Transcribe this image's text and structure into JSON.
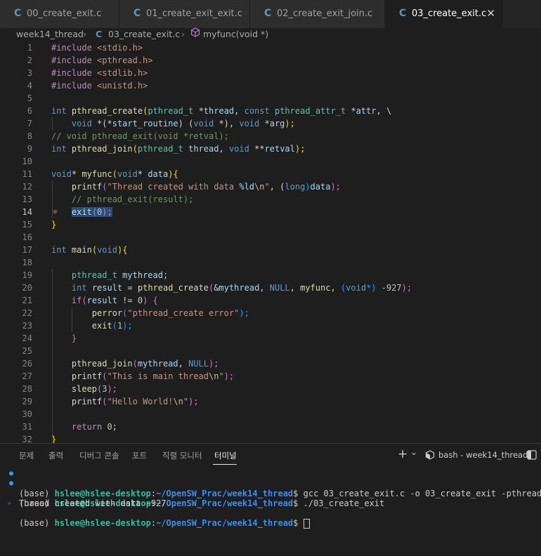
{
  "tabs": [
    {
      "label": "00_create_exit.c",
      "active": false
    },
    {
      "label": "01_create_exit_exit.c",
      "active": false
    },
    {
      "label": "02_create_exit_join.c",
      "active": false
    },
    {
      "label": "03_create_exit.c",
      "active": true
    }
  ],
  "tab_icon": "C",
  "close_glyph": "✕",
  "breadcrumb": {
    "folder": "week14_thread",
    "file": "03_create_exit.c",
    "symbol": "myfunc(void *)",
    "separator": "›"
  },
  "line_numbers": [
    "1",
    "2",
    "3",
    "4",
    "5",
    "6",
    "7",
    "8",
    "9",
    "10",
    "11",
    "12",
    "13",
    "14",
    "15",
    "16",
    "17",
    "18",
    "19",
    "20",
    "21",
    "22",
    "23",
    "24",
    "25",
    "26",
    "27",
    "28",
    "29",
    "30",
    "31",
    "32"
  ],
  "current_line": 14,
  "code": {
    "l1": [
      "#include ",
      "<stdio.h>"
    ],
    "l2": [
      "#include ",
      "<pthread.h>"
    ],
    "l3": [
      "#include ",
      "<stdlib.h>"
    ],
    "l4": [
      "#include ",
      "<unistd.h>"
    ],
    "l6": [
      "int",
      " ",
      "pthread_create",
      "(",
      "pthread_t",
      " *",
      "thread",
      ", ",
      "const",
      " ",
      "pthread_attr_t",
      " *",
      "attr",
      ", \\"
    ],
    "l7": [
      "void",
      " *(*",
      "start_routine",
      ") (",
      "void",
      " *), ",
      "void",
      " *",
      "arg",
      ");"
    ],
    "l8": "// void pthread_exit(void *retval);",
    "l9": [
      "int",
      " ",
      "pthread_join",
      "(",
      "pthread_t",
      " ",
      "thread",
      ", ",
      "void",
      " **",
      "retval",
      ");"
    ],
    "l11": [
      "void",
      "* ",
      "myfunc",
      "(",
      "void",
      "* ",
      "data",
      ")",
      "{"
    ],
    "l12": [
      "printf",
      "(",
      "\"Thread created with data ",
      "%ld",
      "\\n",
      "\"",
      ", (",
      "long",
      ")",
      "data",
      ");"
    ],
    "l13": "// pthread_exit(result);",
    "l14": [
      "exit",
      "(",
      "0",
      ");"
    ],
    "l15": "}",
    "l17": [
      "int",
      " ",
      "main",
      "(",
      "void",
      ")",
      "{"
    ],
    "l19": [
      "pthread_t",
      " ",
      "mythread",
      ";"
    ],
    "l20": [
      "int",
      " ",
      "result",
      " = ",
      "pthread_create",
      "(",
      "&",
      "mythread",
      ", ",
      "NULL",
      ", ",
      "myfunc",
      ", ",
      "(",
      "void",
      "*) ",
      "-927",
      ");"
    ],
    "l21": [
      "if",
      "(",
      "result",
      " != ",
      "0",
      ") ",
      "{"
    ],
    "l22": [
      "perror",
      "(",
      "\"pthread_create error\"",
      ");"
    ],
    "l23": [
      "exit",
      "(",
      "1",
      ");"
    ],
    "l24": "}",
    "l26": [
      "pthread_join",
      "(",
      "mythread",
      ", ",
      "NULL",
      ");"
    ],
    "l27": [
      "printf",
      "(",
      "\"This is main thread",
      "\\n",
      "\"",
      ");"
    ],
    "l28": [
      "sleep",
      "(",
      "3",
      ");"
    ],
    "l29": [
      "printf",
      "(",
      "\"Hello World!",
      "\\n",
      "\"",
      ");"
    ],
    "l31": [
      "return",
      " ",
      "0",
      ";"
    ],
    "l32": "}"
  },
  "panel": {
    "tabs": [
      "문제",
      "출력",
      "디버그 콘솔",
      "포트",
      "직렬 모니터",
      "터미널"
    ],
    "active_tab": "터미널",
    "add_glyph": "+",
    "dropdown_glyph": "⌄",
    "terminal_name": "bash - week14_thread",
    "terminal_icon": "bash-terminal-icon",
    "layout_icon": "split-panel-icon"
  },
  "terminal": {
    "lines": [
      {
        "env": "(base) ",
        "user": "hslee@hslee-desktop",
        "colon": ":",
        "path": "~/OpenSW_Prac/week14_thread",
        "prompt": "$ ",
        "cmd": "gcc 03_create_exit.c -o 03_create_exit -pthread"
      },
      {
        "env": "(base) ",
        "user": "hslee@hslee-desktop",
        "colon": ":",
        "path": "~/OpenSW_Prac/week14_thread",
        "prompt": "$ ",
        "cmd": "./03_create_exit"
      },
      {
        "output": "Thread created with data -927"
      },
      {
        "env": "(base) ",
        "user": "hslee@hslee-desktop",
        "colon": ":",
        "path": "~/OpenSW_Prac/week14_thread",
        "prompt": "$ ",
        "cmd": ""
      }
    ]
  },
  "colors": {
    "editor_bg": "#1e1e1e",
    "keyword": "#569cd6",
    "function": "#dcdcaa",
    "type": "#4ec9b0",
    "variable": "#9cdcfe",
    "string": "#ce9178",
    "comment": "#6a9955",
    "number": "#b5cea8",
    "selection": "#264f78",
    "terminal_user": "#2bbfa0",
    "terminal_path": "#3b8eea"
  }
}
